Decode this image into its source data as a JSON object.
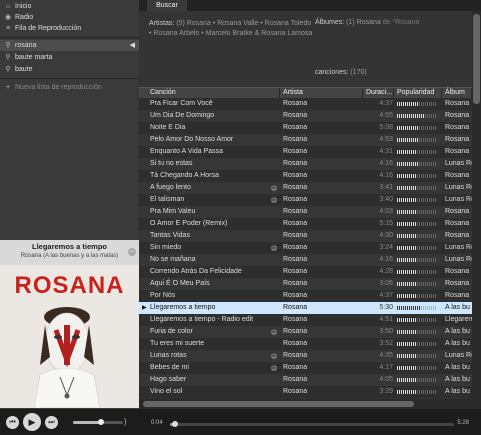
{
  "sidebar": {
    "items": [
      {
        "label": "Inicio",
        "icon": "home-icon"
      },
      {
        "label": "Radio",
        "icon": "radio-icon"
      },
      {
        "label": "Fila de Reproducción",
        "icon": "queue-icon"
      }
    ],
    "searches": [
      {
        "label": "rosana",
        "active": true
      },
      {
        "label": "baute marta"
      },
      {
        "label": "baute"
      }
    ],
    "new_playlist": "Nueva lista de reproducción"
  },
  "now_playing": {
    "title": "Llegaremos a tiempo",
    "subtitle": "Rosana (A las buenas y a las malas)",
    "cover_text": "ROSANA"
  },
  "controls": {
    "volume_fraction": 0.55
  },
  "tabs": [
    {
      "label": "Buscar"
    }
  ],
  "summary": {
    "artistas_label": "Artistas:",
    "artistas_text": "(5) Rosana • Rosana Valle • Rosana Toledo • Rosana Arbelo • Marcelo Bratke & Rosana Lamosa",
    "albumes_label": "Álbumes:",
    "albumes_text": "(1) Rosana",
    "albumes_extra": "de *Rosana",
    "canciones_label": "canciones:",
    "canciones_count": "(170)"
  },
  "table": {
    "columns": [
      "Canción",
      "Artista",
      "Duraci...",
      "Popularidad",
      "Álbum"
    ],
    "rows": [
      {
        "song": "Pra Ficar Com Você",
        "artist": "Rosana",
        "duration": "4:37",
        "pop": 0.55,
        "album": "Rosana"
      },
      {
        "song": "Um Dia De Domingo",
        "artist": "Rosana",
        "duration": "4:55",
        "pop": 0.7,
        "album": "Rosana"
      },
      {
        "song": "Noite E Dia",
        "artist": "Rosana",
        "duration": "5:08",
        "pop": 0.55,
        "album": "Rosana"
      },
      {
        "song": "Pelo Amor Do Nosso Amor",
        "artist": "Rosana",
        "duration": "4:53",
        "pop": 0.55,
        "album": "Rosana"
      },
      {
        "song": "Enquanto A Vida Passa",
        "artist": "Rosana",
        "duration": "4:31",
        "pop": 0.5,
        "album": "Rosana"
      },
      {
        "song": "Si tu no estas",
        "artist": "Rosana",
        "duration": "4:16",
        "pop": 0.55,
        "album": "Lunas Ro"
      },
      {
        "song": "Tá Chegando A Horsa",
        "artist": "Rosana",
        "duration": "4:16",
        "pop": 0.5,
        "album": "Rosana"
      },
      {
        "song": "A fuego lento",
        "artist": "Rosana",
        "duration": "3:41",
        "pop": 0.5,
        "album": "Lunas Ro",
        "badge": true
      },
      {
        "song": "El talisman",
        "artist": "Rosana",
        "duration": "3:40",
        "pop": 0.5,
        "album": "Lunas Ro",
        "badge": true
      },
      {
        "song": "Pra Mim Valeu",
        "artist": "Rosana",
        "duration": "4:03",
        "pop": 0.5,
        "album": "Rosana"
      },
      {
        "song": "O Amor E Poder (Remix)",
        "artist": "Rosana",
        "duration": "5:15",
        "pop": 0.5,
        "album": "Rosana"
      },
      {
        "song": "Tantas Vidas",
        "artist": "Rosana",
        "duration": "4:30",
        "pop": 0.5,
        "album": "Rosana"
      },
      {
        "song": "Sin miedo",
        "artist": "Rosana",
        "duration": "3:24",
        "pop": 0.5,
        "album": "Lunas Ro",
        "badge": true
      },
      {
        "song": "No se mañana",
        "artist": "Rosana",
        "duration": "4:16",
        "pop": 0.5,
        "album": "Lunas Ro"
      },
      {
        "song": "Correndo Atrás Da Felicidade",
        "artist": "Rosana",
        "duration": "4:28",
        "pop": 0.5,
        "album": "Rosana"
      },
      {
        "song": "Aqui É O Meu País",
        "artist": "Rosana",
        "duration": "3:06",
        "pop": 0.5,
        "album": "Rosana"
      },
      {
        "song": "Por Nós",
        "artist": "Rosana",
        "duration": "4:37",
        "pop": 0.5,
        "album": "Rosana"
      },
      {
        "song": "Llegaremos a tiempo",
        "artist": "Rosana",
        "duration": "5:30",
        "pop": 0.6,
        "album": "A las bu",
        "selected": true,
        "playing": true
      },
      {
        "song": "Llegaremos a tiempo - Radio edit",
        "artist": "Rosana",
        "duration": "4:51",
        "pop": 0.5,
        "album": "Llegarem"
      },
      {
        "song": "Furia de color",
        "artist": "Rosana",
        "duration": "3:50",
        "pop": 0.5,
        "album": "A las bu",
        "badge": true
      },
      {
        "song": "Tu eres mi suerte",
        "artist": "Rosana",
        "duration": "3:52",
        "pop": 0.5,
        "album": "A las bu"
      },
      {
        "song": "Lunas rotas",
        "artist": "Rosana",
        "duration": "4:35",
        "pop": 0.5,
        "album": "Lunas Ro",
        "badge": true
      },
      {
        "song": "Bebes de mi",
        "artist": "Rosana",
        "duration": "4:17",
        "pop": 0.5,
        "album": "A las bu",
        "badge": true
      },
      {
        "song": "Hago saber",
        "artist": "Rosana",
        "duration": "4:05",
        "pop": 0.5,
        "album": "A las bu"
      },
      {
        "song": "Vino el sol",
        "artist": "Rosana",
        "duration": "3:29",
        "pop": 0.5,
        "album": "A las bu"
      }
    ]
  },
  "playback": {
    "current": "0:04",
    "total": "5:28",
    "progress_fraction": 0.012
  }
}
